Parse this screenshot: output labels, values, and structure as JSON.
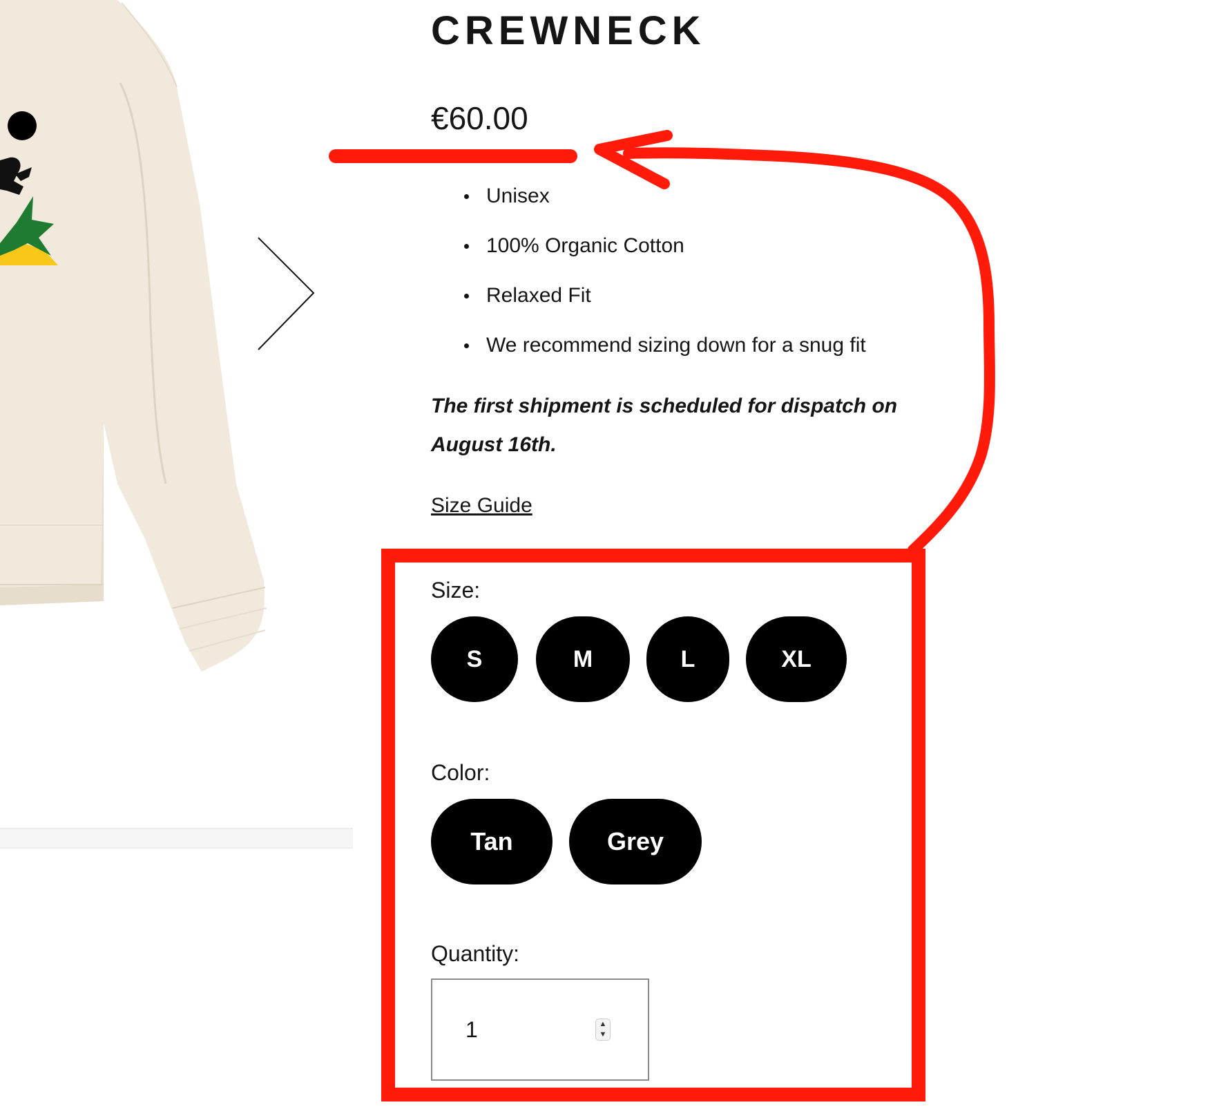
{
  "product": {
    "title": "CREWNECK",
    "price": "€60.00",
    "features": [
      "Unisex",
      "100% Organic Cotton",
      "Relaxed Fit",
      "We recommend sizing down for a snug fit"
    ],
    "shipment_note": "The first shipment is scheduled for dispatch on August 16th.",
    "size_guide_label": "Size Guide"
  },
  "options": {
    "size_label": "Size:",
    "sizes": [
      "S",
      "M",
      "L",
      "XL"
    ],
    "color_label": "Color:",
    "colors": [
      "Tan",
      "Grey"
    ],
    "quantity_label": "Quantity:",
    "quantity_value": "1"
  },
  "icons": {
    "next": "chevron-right-icon",
    "stepper_up": "chevron-up-icon",
    "stepper_down": "chevron-down-icon"
  },
  "colors": {
    "annotation": "#ff1a0a",
    "button_bg": "#000000",
    "button_text": "#ffffff",
    "sweater": "#f1eadc",
    "sweater_shadow": "#ddd3c2",
    "graphic_green": "#1f7a32",
    "graphic_yellow": "#f7c81a"
  }
}
